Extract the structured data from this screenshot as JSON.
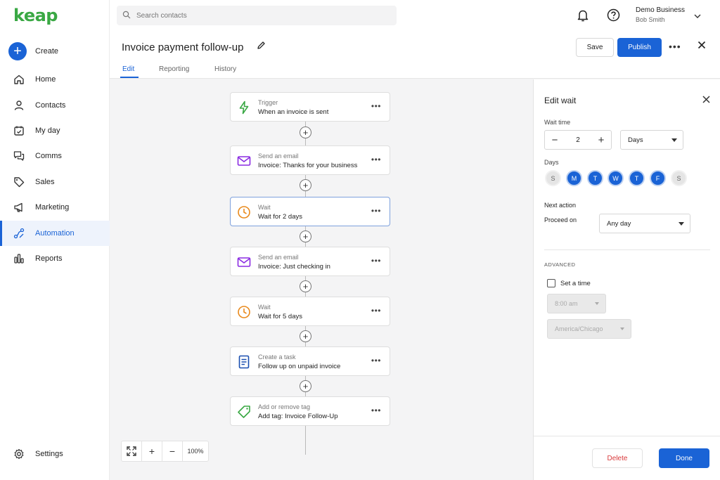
{
  "brand": {
    "logo": "keap",
    "accent": "#1a63d6",
    "logo_color": "#3aa844"
  },
  "sidebar": {
    "create_label": "Create",
    "items": [
      {
        "label": "Home",
        "icon": "home-icon"
      },
      {
        "label": "Contacts",
        "icon": "person-icon"
      },
      {
        "label": "My day",
        "icon": "calendar-icon"
      },
      {
        "label": "Comms",
        "icon": "chat-icon"
      },
      {
        "label": "Sales",
        "icon": "tag-icon"
      },
      {
        "label": "Marketing",
        "icon": "megaphone-icon"
      },
      {
        "label": "Automation",
        "icon": "automation-icon",
        "active": true
      },
      {
        "label": "Reports",
        "icon": "bar-chart-icon"
      }
    ],
    "settings_label": "Settings"
  },
  "topbar": {
    "search_placeholder": "Search contacts",
    "account_business": "Demo Business",
    "account_user": "Bob Smith"
  },
  "header": {
    "title": "Invoice payment follow-up",
    "tabs": [
      {
        "label": "Edit",
        "active": true
      },
      {
        "label": "Reporting"
      },
      {
        "label": "History"
      }
    ],
    "save_label": "Save",
    "publish_label": "Publish",
    "more_label": "•••"
  },
  "flow": {
    "nodes": [
      {
        "type": "Trigger",
        "text": "When an invoice is sent",
        "icon": "lightning-icon"
      },
      {
        "type": "Send an email",
        "text": "Invoice: Thanks for your business",
        "icon": "envelope-icon"
      },
      {
        "type": "Wait",
        "text": "Wait for 2 days",
        "icon": "clock-icon",
        "selected": true
      },
      {
        "type": "Send an email",
        "text": "Invoice: Just checking in",
        "icon": "envelope-icon"
      },
      {
        "type": "Wait",
        "text": "Wait for 5 days",
        "icon": "clock-icon"
      },
      {
        "type": "Create a task",
        "text": "Follow up on unpaid invoice",
        "icon": "task-icon"
      },
      {
        "type": "Add or remove tag",
        "text": "Add tag: Invoice Follow-Up",
        "icon": "tag-icon"
      }
    ],
    "node_menu": "•••",
    "add_symbol": "+"
  },
  "zoom": {
    "fit_icon": "fit-screen-icon",
    "plus": "+",
    "minus": "−",
    "level": "100%"
  },
  "panel": {
    "title": "Edit wait",
    "wait_time_label": "Wait time",
    "wait_value": "2",
    "unit_value": "Days",
    "days_label": "Days",
    "days": [
      {
        "label": "S",
        "on": false
      },
      {
        "label": "M",
        "on": true
      },
      {
        "label": "T",
        "on": true
      },
      {
        "label": "W",
        "on": true
      },
      {
        "label": "T",
        "on": true
      },
      {
        "label": "F",
        "on": true
      },
      {
        "label": "S",
        "on": false
      }
    ],
    "next_action_label": "Next action",
    "proceed_on_label": "Proceed on",
    "proceed_on_value": "Any day",
    "advanced_label": "ADVANCED",
    "set_time_label": "Set a time",
    "set_time_checked": false,
    "time_value": "8:00 am",
    "timezone_value": "America/Chicago",
    "delete_label": "Delete",
    "done_label": "Done"
  }
}
